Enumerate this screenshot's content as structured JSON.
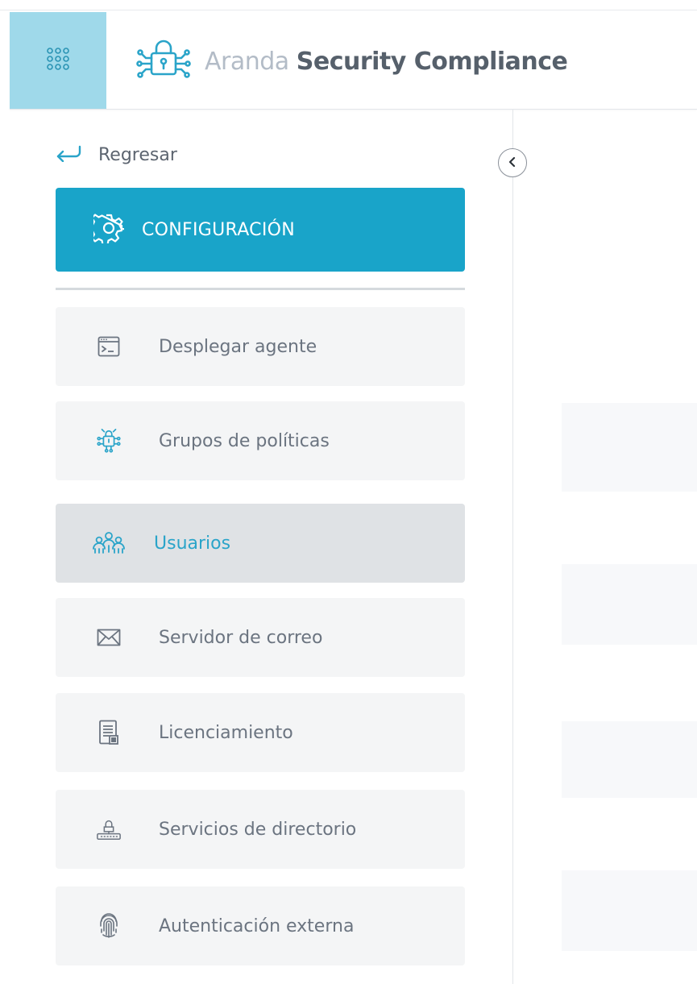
{
  "header": {
    "brand_light": "Aranda",
    "brand_bold": "Security Compliance",
    "apps_icon": "grid-dots-icon",
    "logo_icon": "circuit-lock-icon"
  },
  "sidebar": {
    "back_label": "Regresar",
    "section_title": "CONFIGURACIÓN",
    "section_icon": "gear-icon",
    "items": [
      {
        "label": "Desplegar agente",
        "icon": "terminal-window-icon",
        "active": false
      },
      {
        "label": "Grupos de políticas",
        "icon": "circuit-lock-icon",
        "active": false
      },
      {
        "label": "Usuarios",
        "icon": "users-group-icon",
        "active": true
      },
      {
        "label": "Servidor de correo",
        "icon": "envelope-icon",
        "active": false
      },
      {
        "label": "Licenciamiento",
        "icon": "license-document-icon",
        "active": false
      },
      {
        "label": "Servicios de directorio",
        "icon": "directory-server-icon",
        "active": false
      },
      {
        "label": "Autenticación externa",
        "icon": "fingerprint-icon",
        "active": false
      }
    ]
  },
  "colors": {
    "accent": "#19a4c9",
    "apps_button_bg": "#9fd9ea",
    "item_bg": "#f4f5f6",
    "active_item_bg": "#dfe2e5",
    "active_text": "#2aa4c9",
    "text": "#6b7480"
  }
}
